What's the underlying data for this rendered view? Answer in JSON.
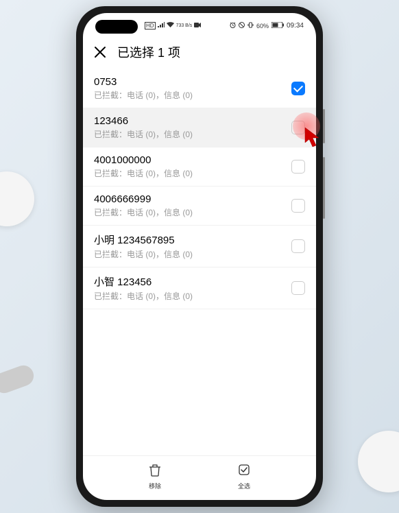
{
  "status_bar": {
    "network_indicator": "⬛",
    "signal": "⁴ᴳ",
    "wifi_speed": "733 B/s",
    "video_icon": "📹",
    "alarm_icon": "⏰",
    "do_not_disturb": "⊘",
    "vibrate": "📳",
    "battery_percent": "60%",
    "battery_icon": "🔋",
    "time": "09:34"
  },
  "header": {
    "title": "已选择 1 项"
  },
  "list": [
    {
      "title": "0753",
      "subtitle": "已拦截：电话 (0)，信息 (0)",
      "checked": true,
      "highlighted": false
    },
    {
      "title": "123466",
      "subtitle": "已拦截：电话 (0)，信息 (0)",
      "checked": false,
      "highlighted": true
    },
    {
      "title": "4001000000",
      "subtitle": "已拦截：电话 (0)，信息 (0)",
      "checked": false,
      "highlighted": false
    },
    {
      "title": "4006666999",
      "subtitle": "已拦截：电话 (0)，信息 (0)",
      "checked": false,
      "highlighted": false
    },
    {
      "title": "小明 1234567895",
      "subtitle": "已拦截：电话 (0)，信息 (0)",
      "checked": false,
      "highlighted": false
    },
    {
      "title": "小智 123456",
      "subtitle": "已拦截：电话 (0)，信息 (0)",
      "checked": false,
      "highlighted": false
    }
  ],
  "bottom_bar": {
    "remove_label": "移除",
    "select_all_label": "全选"
  }
}
